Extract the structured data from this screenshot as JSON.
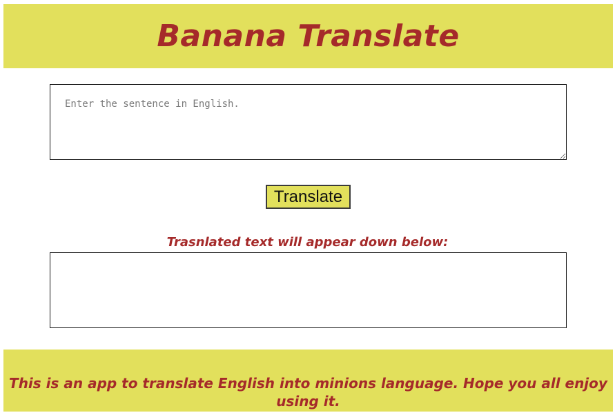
{
  "header": {
    "title": "Banana Translate"
  },
  "input": {
    "placeholder": "Enter the sentence in English.",
    "value": ""
  },
  "button": {
    "label": "Translate"
  },
  "output": {
    "label": "Trasnlated text will appear down below:",
    "value": ""
  },
  "footer": {
    "text": "This is an app to translate English into minions language. Hope you all enjoy using it."
  },
  "colors": {
    "accent_bg": "#e2e05c",
    "accent_text": "#a52a2a"
  }
}
